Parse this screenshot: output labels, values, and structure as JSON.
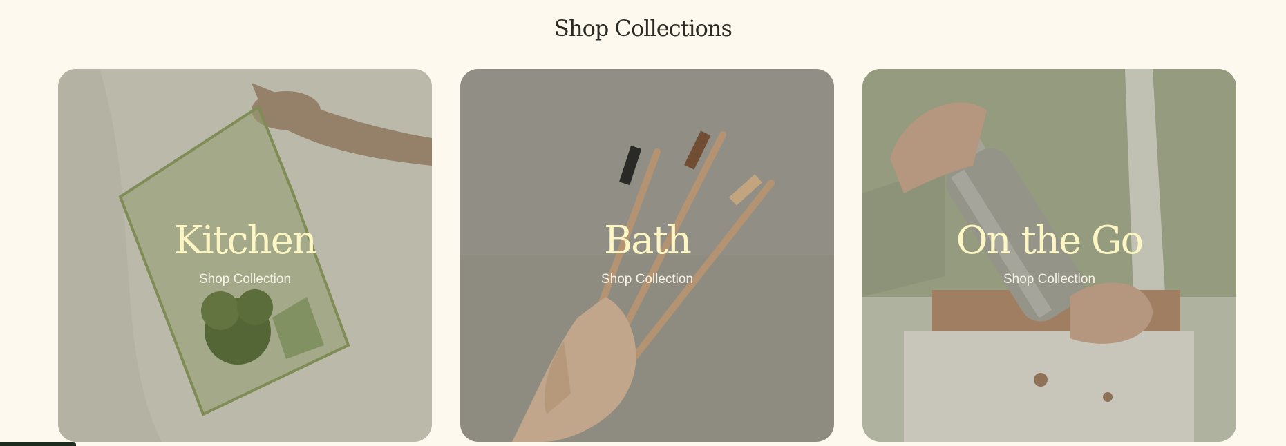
{
  "section": {
    "title": "Shop Collections"
  },
  "collections": [
    {
      "title": "Kitchen",
      "link_label": "Shop Collection",
      "image": "produce-bag-broccoli"
    },
    {
      "title": "Bath",
      "link_label": "Shop Collection",
      "image": "bamboo-toothbrushes"
    },
    {
      "title": "On the Go",
      "link_label": "Shop Collection",
      "image": "steel-water-bottle"
    }
  ],
  "colors": {
    "background": "#fdf9ee",
    "title_text": "#2b2b26",
    "card_title": "#fcf6c4",
    "card_link": "#f6f2e6"
  }
}
